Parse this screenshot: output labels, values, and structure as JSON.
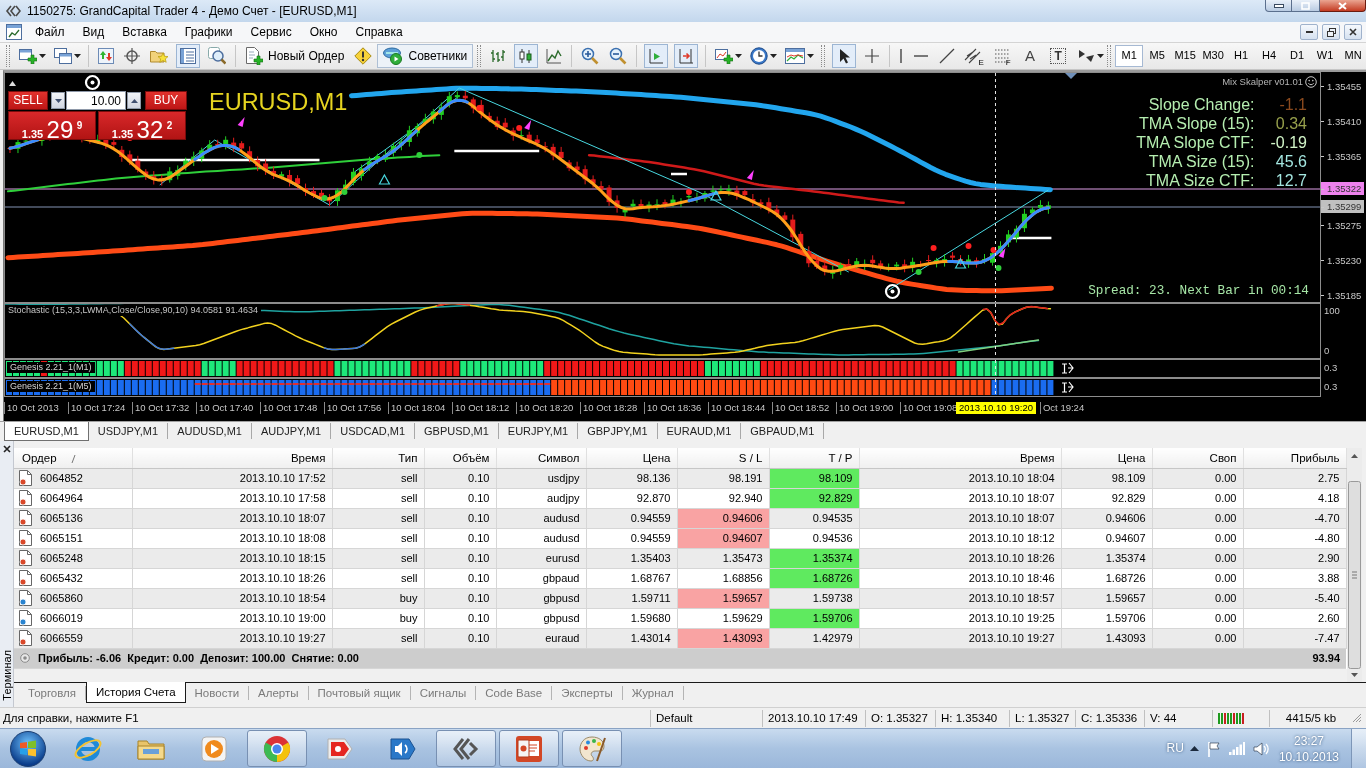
{
  "window": {
    "title": "1150275: GrandCapital Trader 4 - Демо Счет - [EURUSD,M1]"
  },
  "menu": [
    {
      "label": "Файл"
    },
    {
      "label": "Вид"
    },
    {
      "label": "Вставка"
    },
    {
      "label": "Графики"
    },
    {
      "label": "Сервис"
    },
    {
      "label": "Окно"
    },
    {
      "label": "Справка"
    }
  ],
  "toolbar": {
    "new_order": "Новый Ордер",
    "experts": "Советники",
    "drawing_tools": [
      {
        "kind": "channel",
        "mark": "E"
      },
      {
        "kind": "fibo",
        "mark": "F"
      },
      {
        "kind": "text",
        "mark": "A"
      },
      {
        "kind": "label",
        "mark": "T"
      }
    ],
    "timeframes": [
      {
        "label": "M1",
        "selected": true
      },
      {
        "label": "M5",
        "selected": false
      },
      {
        "label": "M15",
        "selected": false
      },
      {
        "label": "M30",
        "selected": false
      },
      {
        "label": "H1",
        "selected": false
      },
      {
        "label": "H4",
        "selected": false
      },
      {
        "label": "D1",
        "selected": false
      },
      {
        "label": "W1",
        "selected": false
      },
      {
        "label": "MN",
        "selected": false
      }
    ]
  },
  "chart": {
    "title": "EURUSD,M1",
    "trade_panel": {
      "sell_label": "SELL",
      "buy_label": "BUY",
      "volume": "10.00",
      "bid": {
        "prefix": "1.35",
        "pips": "29",
        "fraction": "9"
      },
      "ask": {
        "prefix": "1.35",
        "pips": "32",
        "fraction": "2"
      }
    },
    "indicator_name": "Mix Skalper v01.01",
    "readouts": [
      {
        "label": "Slope Change:",
        "value": "-1.1",
        "color": "#8b4a1e"
      },
      {
        "label": "TMA Slope (15):",
        "value": "0.34",
        "color": "#97a04c"
      },
      {
        "label": "TMA Slope CTF:",
        "value": "-0.19",
        "color": "#d2f5c8"
      },
      {
        "label": "TMA Size (15):",
        "value": "45.6",
        "color": "#a4e6e0"
      },
      {
        "label": "TMA Size CTF:",
        "value": "12.7",
        "color": "#a4e6e0"
      }
    ],
    "spread": "Spread: 23. Next Bar in 00:14",
    "price_axis": [
      {
        "label": "1.35455",
        "kind": "tick"
      },
      {
        "label": "1.35410",
        "kind": "tick"
      },
      {
        "label": "1.35365",
        "kind": "tick"
      },
      {
        "label": "1.35322",
        "kind": "ask"
      },
      {
        "label": "1.35299",
        "kind": "bid"
      },
      {
        "label": "1.35275",
        "kind": "tick"
      },
      {
        "label": "1.35230",
        "kind": "tick"
      },
      {
        "label": "1.35185",
        "kind": "tick"
      }
    ],
    "stochastic": {
      "label": "Stochastic (15,3,3,LWMA,Close/Close,90,10) 94.0581 91.4634",
      "scale": [
        "100",
        "0"
      ]
    },
    "genesis": [
      {
        "label": "Genesis 2.21_1(M1)",
        "scale": "0.3"
      },
      {
        "label": "Genesis 2.21_1(M5)",
        "scale": "0.3"
      }
    ],
    "time_axis": [
      {
        "label": "10 Oct 2013",
        "kind": "tick"
      },
      {
        "label": "10 Oct 17:24",
        "kind": "tick"
      },
      {
        "label": "10 Oct 17:32",
        "kind": "tick"
      },
      {
        "label": "10 Oct 17:40",
        "kind": "tick"
      },
      {
        "label": "10 Oct 17:48",
        "kind": "tick"
      },
      {
        "label": "10 Oct 17:56",
        "kind": "tick"
      },
      {
        "label": "10 Oct 18:04",
        "kind": "tick"
      },
      {
        "label": "10 Oct 18:12",
        "kind": "tick"
      },
      {
        "label": "10 Oct 18:20",
        "kind": "tick"
      },
      {
        "label": "10 Oct 18:28",
        "kind": "tick"
      },
      {
        "label": "10 Oct 18:36",
        "kind": "tick"
      },
      {
        "label": "10 Oct 18:44",
        "kind": "tick"
      },
      {
        "label": "10 Oct 18:52",
        "kind": "tick"
      },
      {
        "label": "10 Oct 19:00",
        "kind": "tick"
      },
      {
        "label": "10 Oct 19:08",
        "kind": "tick"
      },
      {
        "label": "2013.10.10 19:20",
        "kind": "cursor"
      },
      {
        "label": "Oct 19:24",
        "kind": "tick"
      }
    ]
  },
  "symbol_tabs": [
    {
      "label": "EURUSD,M1",
      "selected": true
    },
    {
      "label": "USDJPY,M1",
      "selected": false
    },
    {
      "label": "AUDUSD,M1",
      "selected": false
    },
    {
      "label": "AUDJPY,M1",
      "selected": false
    },
    {
      "label": "USDCAD,M1",
      "selected": false
    },
    {
      "label": "GBPUSD,M1",
      "selected": false
    },
    {
      "label": "EURJPY,M1",
      "selected": false
    },
    {
      "label": "GBPJPY,M1",
      "selected": false
    },
    {
      "label": "EURAUD,M1",
      "selected": false
    },
    {
      "label": "GBPAUD,M1",
      "selected": false
    }
  ],
  "terminal": {
    "title": "Терминал",
    "columns": [
      "Ордер",
      "Время",
      "Тип",
      "Объём",
      "Символ",
      "Цена",
      "S / L",
      "T / P",
      "Время",
      "Цена",
      "Своп",
      "Прибыль"
    ],
    "rows": [
      {
        "kind": "sell",
        "sl_hit": false,
        "tp_hit": true,
        "cells": [
          "6064852",
          "2013.10.10 17:52",
          "sell",
          "0.10",
          "usdjpy",
          "98.136",
          "98.191",
          "98.109",
          "2013.10.10 18:04",
          "98.109",
          "0.00",
          "2.75"
        ]
      },
      {
        "kind": "sell",
        "sl_hit": false,
        "tp_hit": true,
        "cells": [
          "6064964",
          "2013.10.10 17:58",
          "sell",
          "0.10",
          "audjpy",
          "92.870",
          "92.940",
          "92.829",
          "2013.10.10 18:07",
          "92.829",
          "0.00",
          "4.18"
        ]
      },
      {
        "kind": "sell",
        "sl_hit": true,
        "tp_hit": false,
        "cells": [
          "6065136",
          "2013.10.10 18:07",
          "sell",
          "0.10",
          "audusd",
          "0.94559",
          "0.94606",
          "0.94535",
          "2013.10.10 18:07",
          "0.94606",
          "0.00",
          "-4.70"
        ]
      },
      {
        "kind": "sell",
        "sl_hit": true,
        "tp_hit": false,
        "cells": [
          "6065151",
          "2013.10.10 18:08",
          "sell",
          "0.10",
          "audusd",
          "0.94559",
          "0.94607",
          "0.94536",
          "2013.10.10 18:12",
          "0.94607",
          "0.00",
          "-4.80"
        ]
      },
      {
        "kind": "sell",
        "sl_hit": false,
        "tp_hit": true,
        "cells": [
          "6065248",
          "2013.10.10 18:15",
          "sell",
          "0.10",
          "eurusd",
          "1.35403",
          "1.35473",
          "1.35374",
          "2013.10.10 18:26",
          "1.35374",
          "0.00",
          "2.90"
        ]
      },
      {
        "kind": "sell",
        "sl_hit": false,
        "tp_hit": true,
        "cells": [
          "6065432",
          "2013.10.10 18:26",
          "sell",
          "0.10",
          "gbpaud",
          "1.68767",
          "1.68856",
          "1.68726",
          "2013.10.10 18:46",
          "1.68726",
          "0.00",
          "3.88"
        ]
      },
      {
        "kind": "buy",
        "sl_hit": true,
        "tp_hit": false,
        "cells": [
          "6065860",
          "2013.10.10 18:54",
          "buy",
          "0.10",
          "gbpusd",
          "1.59711",
          "1.59657",
          "1.59738",
          "2013.10.10 18:57",
          "1.59657",
          "0.00",
          "-5.40"
        ]
      },
      {
        "kind": "buy",
        "sl_hit": false,
        "tp_hit": true,
        "cells": [
          "6066019",
          "2013.10.10 19:00",
          "buy",
          "0.10",
          "gbpusd",
          "1.59680",
          "1.59629",
          "1.59706",
          "2013.10.10 19:25",
          "1.59706",
          "0.00",
          "2.60"
        ]
      },
      {
        "kind": "sell",
        "sl_hit": true,
        "tp_hit": false,
        "cells": [
          "6066559",
          "2013.10.10 19:27",
          "sell",
          "0.10",
          "euraud",
          "1.43014",
          "1.43093",
          "1.42979",
          "2013.10.10 19:27",
          "1.43093",
          "0.00",
          "-7.47"
        ]
      }
    ],
    "summary": {
      "text": "Прибыль: -6.06  Кредит: 0.00  Депозит: 100.00  Снятие: 0.00",
      "total": "93.94"
    },
    "tabs": [
      {
        "label": "Торговля",
        "selected": false
      },
      {
        "label": "История Счета",
        "selected": true
      },
      {
        "label": "Новости",
        "selected": false
      },
      {
        "label": "Алерты",
        "selected": false
      },
      {
        "label": "Почтовый ящик",
        "selected": false
      },
      {
        "label": "Сигналы",
        "selected": false
      },
      {
        "label": "Code Base",
        "selected": false
      },
      {
        "label": "Эксперты",
        "selected": false
      },
      {
        "label": "Журнал",
        "selected": false
      }
    ]
  },
  "status_bar": {
    "help": "Для справки, нажмите F1",
    "profile": "Default",
    "datetime": "2013.10.10 17:49",
    "open": "O: 1.35327",
    "high": "H: 1.35340",
    "low": "L: 1.35327",
    "close": "C: 1.35336",
    "volume": "V: 44",
    "traffic": "4415/5 kb"
  },
  "taskbar": {
    "apps": [
      {
        "kind": "globe",
        "running": false
      },
      {
        "kind": "folder",
        "running": false
      },
      {
        "kind": "player",
        "running": false
      },
      {
        "kind": "wheel",
        "running": true
      },
      {
        "kind": "tag",
        "running": false
      },
      {
        "kind": "speaker",
        "running": false
      },
      {
        "kind": "chevrons",
        "running": true
      },
      {
        "kind": "slides",
        "running": true
      },
      {
        "kind": "palette",
        "running": true
      }
    ],
    "language": "RU",
    "time": "23:27",
    "date": "10.10.2013"
  }
}
